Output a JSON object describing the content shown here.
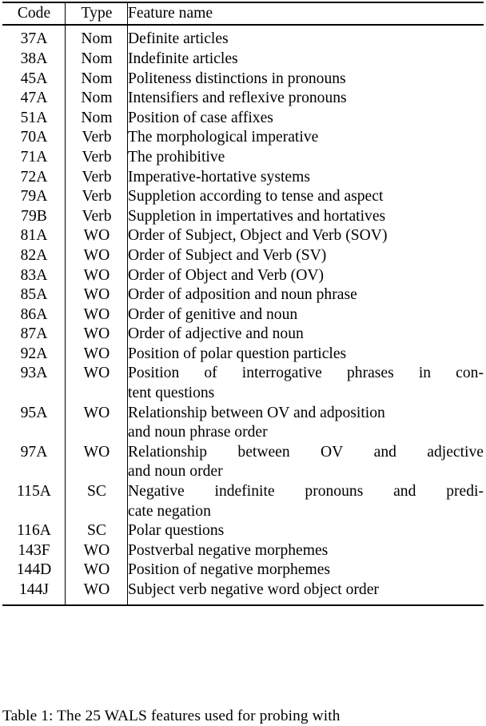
{
  "table": {
    "columns": [
      "Code",
      "Type",
      "Feature name"
    ],
    "rows": [
      {
        "code": "37A",
        "type": "Nom",
        "name": "Definite articles"
      },
      {
        "code": "38A",
        "type": "Nom",
        "name": "Indefinite articles"
      },
      {
        "code": "45A",
        "type": "Nom",
        "name": "Politeness distinctions in pronouns"
      },
      {
        "code": "47A",
        "type": "Nom",
        "name": "Intensifiers and reflexive pronouns"
      },
      {
        "code": "51A",
        "type": "Nom",
        "name": "Position of case affixes"
      },
      {
        "code": "70A",
        "type": "Verb",
        "name": "The morphological imperative"
      },
      {
        "code": "71A",
        "type": "Verb",
        "name": "The prohibitive"
      },
      {
        "code": "72A",
        "type": "Verb",
        "name": "Imperative-hortative systems"
      },
      {
        "code": "79A",
        "type": "Verb",
        "name": "Suppletion according to tense and aspect"
      },
      {
        "code": "79B",
        "type": "Verb",
        "name": "Suppletion in impertatives and hortatives"
      },
      {
        "code": "81A",
        "type": "WO",
        "name": "Order of Subject, Object and Verb (SOV)"
      },
      {
        "code": "82A",
        "type": "WO",
        "name": "Order of Subject and Verb (SV)"
      },
      {
        "code": "83A",
        "type": "WO",
        "name": "Order of Object and Verb (OV)"
      },
      {
        "code": "85A",
        "type": "WO",
        "name": "Order of adposition and noun phrase"
      },
      {
        "code": "86A",
        "type": "WO",
        "name": "Order of genitive and noun"
      },
      {
        "code": "87A",
        "type": "WO",
        "name": "Order of adjective and noun"
      },
      {
        "code": "92A",
        "type": "WO",
        "name": "Position of polar question particles"
      },
      {
        "code": "93A",
        "type": "WO",
        "name": "Position of interrogative phrases in content questions",
        "lines": [
          "Position of interrogative phrases in con-",
          "tent questions"
        ],
        "justify": [
          true,
          false
        ]
      },
      {
        "code": "95A",
        "type": "WO",
        "name": "Relationship between OV and adposition and noun phrase order",
        "lines": [
          "Relationship between OV and adposition",
          "and noun phrase order"
        ],
        "justify": [
          false,
          false
        ]
      },
      {
        "code": "97A",
        "type": "WO",
        "name": "Relationship between OV and adjective and noun order",
        "lines": [
          "Relationship between OV and adjective",
          "and noun order"
        ],
        "justify": [
          true,
          false
        ]
      },
      {
        "code": "115A",
        "type": "SC",
        "name": "Negative indefinite pronouns and predicate negation",
        "lines": [
          "Negative indefinite pronouns and predi-",
          "cate negation"
        ],
        "justify": [
          true,
          false
        ]
      },
      {
        "code": "116A",
        "type": "SC",
        "name": "Polar questions"
      },
      {
        "code": "143F",
        "type": "WO",
        "name": "Postverbal negative morphemes"
      },
      {
        "code": "144D",
        "type": "WO",
        "name": "Position of negative morphemes"
      },
      {
        "code": "144J",
        "type": "WO",
        "name": "Subject verb negative word object order"
      }
    ]
  },
  "caption": {
    "text": "Table 1: The 25 WALS features used for probing with"
  }
}
